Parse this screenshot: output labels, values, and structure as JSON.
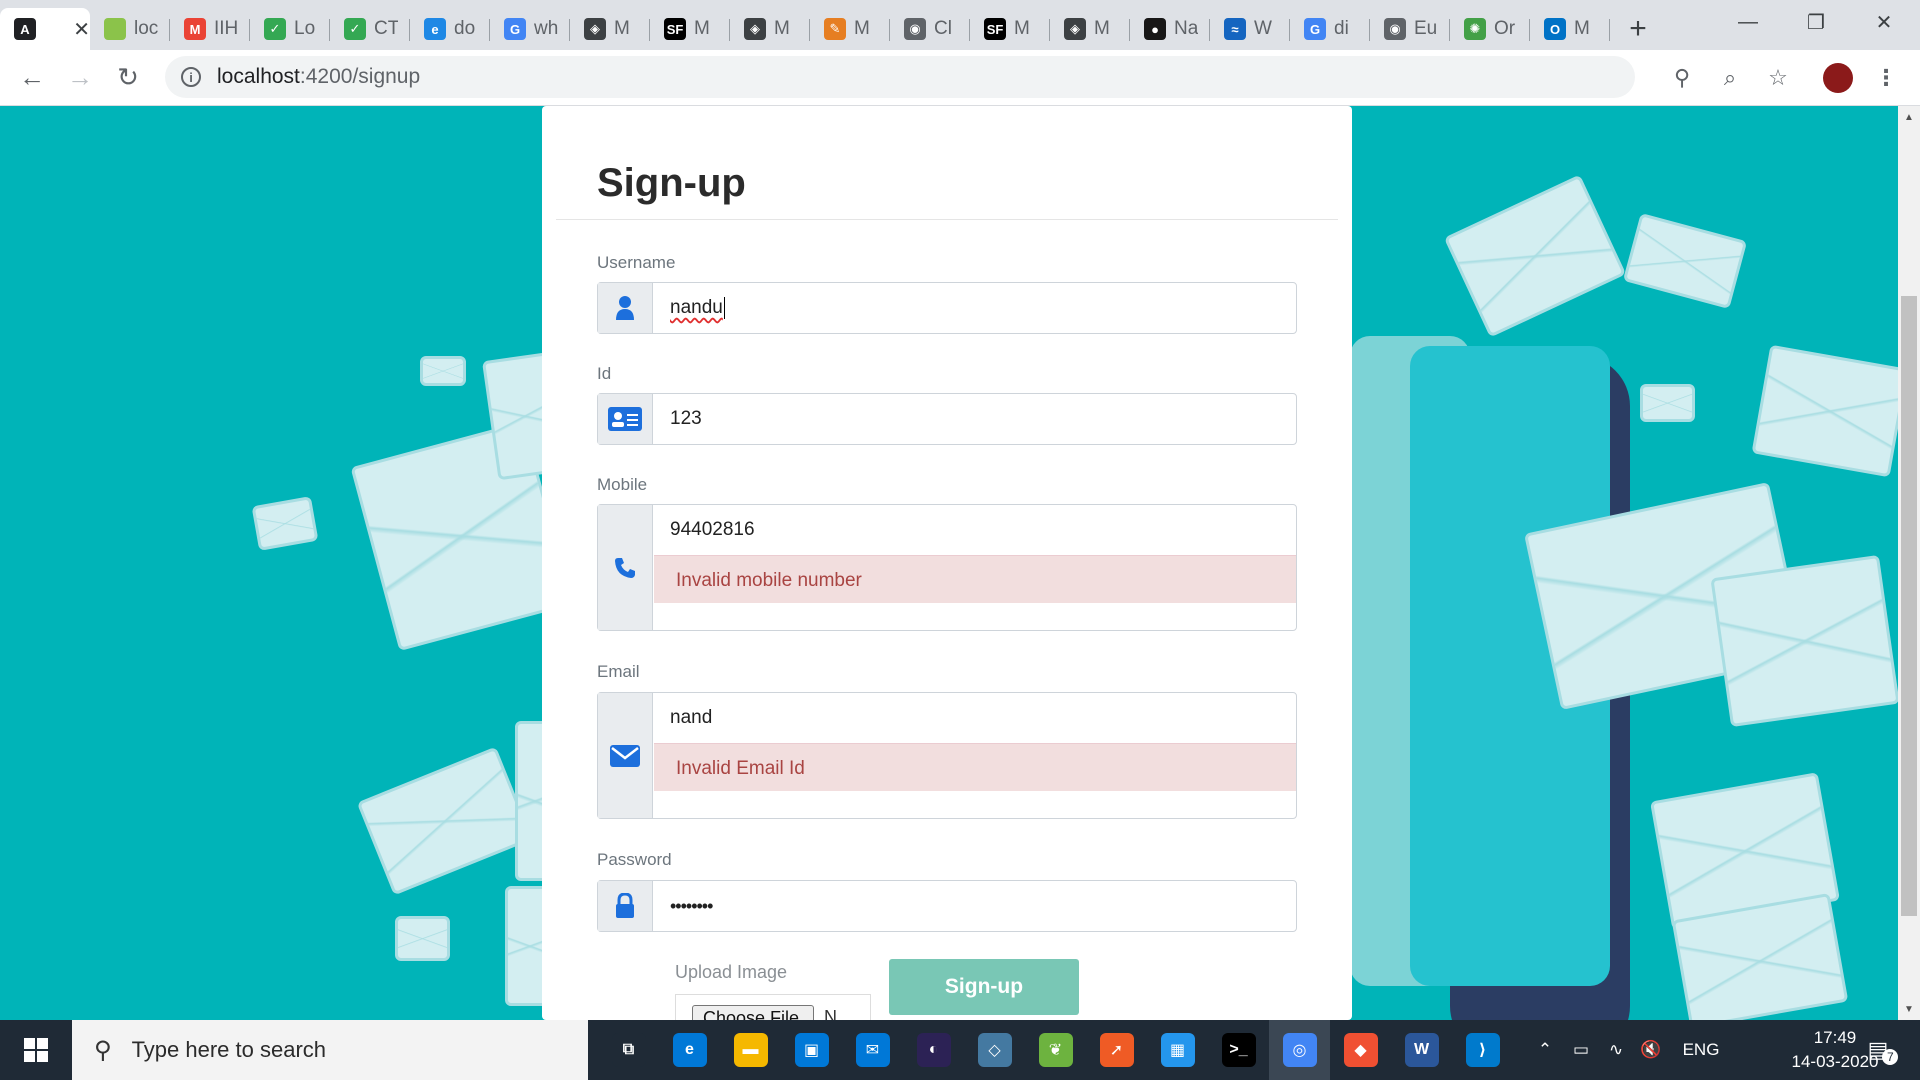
{
  "browser": {
    "tabs": [
      {
        "title": "",
        "icon": "angular-icon",
        "color": "#202124",
        "glyph": "A",
        "active": true
      },
      {
        "title": "loc",
        "icon": "leaf-icon",
        "color": "#8bc34a",
        "glyph": ""
      },
      {
        "title": "IIH",
        "icon": "gmail-icon",
        "color": "#ea4335",
        "glyph": "M"
      },
      {
        "title": "Lo",
        "icon": "check-icon",
        "color": "#34a853",
        "glyph": "✓"
      },
      {
        "title": "CT",
        "icon": "check-icon",
        "color": "#34a853",
        "glyph": "✓"
      },
      {
        "title": "do",
        "icon": "edge-icon",
        "color": "#1e88e5",
        "glyph": "e"
      },
      {
        "title": "wh",
        "icon": "google-icon",
        "color": "#4285f4",
        "glyph": "G"
      },
      {
        "title": "M",
        "icon": "diamond-icon",
        "color": "#3c4043",
        "glyph": "◈"
      },
      {
        "title": "M",
        "icon": "sf-icon",
        "color": "#000000",
        "glyph": "SF"
      },
      {
        "title": "M",
        "icon": "diamond-icon",
        "color": "#3c4043",
        "glyph": "◈"
      },
      {
        "title": "M",
        "icon": "brush-icon",
        "color": "#e67e22",
        "glyph": "✎"
      },
      {
        "title": "Cl",
        "icon": "globe-icon",
        "color": "#5f6368",
        "glyph": "◉"
      },
      {
        "title": "M",
        "icon": "sf-icon",
        "color": "#000000",
        "glyph": "SF"
      },
      {
        "title": "M",
        "icon": "diamond-icon",
        "color": "#3c4043",
        "glyph": "◈"
      },
      {
        "title": "Na",
        "icon": "github-icon",
        "color": "#181717",
        "glyph": "●"
      },
      {
        "title": "W",
        "icon": "wave-icon",
        "color": "#1565c0",
        "glyph": "≈"
      },
      {
        "title": "di",
        "icon": "google-icon",
        "color": "#4285f4",
        "glyph": "G"
      },
      {
        "title": "Eu",
        "icon": "globe-icon",
        "color": "#5f6368",
        "glyph": "◉"
      },
      {
        "title": "Or",
        "icon": "spinner-icon",
        "color": "#43a047",
        "glyph": "✺"
      },
      {
        "title": "M",
        "icon": "outlook-icon",
        "color": "#0072c6",
        "glyph": "O"
      }
    ],
    "new_tab": "+",
    "url_host": "localhost",
    "url_path": ":4200/signup"
  },
  "form": {
    "title": "Sign-up",
    "username_label": "Username",
    "username_value": "nandu",
    "id_label": "Id",
    "id_value": "123",
    "mobile_label": "Mobile",
    "mobile_value": "94402816",
    "mobile_error": "Invalid mobile number",
    "email_label": "Email",
    "email_value": "nand",
    "email_error": "Invalid Email Id",
    "password_label": "Password",
    "password_value": "••••••••",
    "upload_label": "Upload Image",
    "choose_file": "Choose File",
    "no_file": "N",
    "signup_button": "Sign-up"
  },
  "taskbar": {
    "search_placeholder": "Type here to search",
    "apps": [
      {
        "icon": "task-view-icon",
        "color": "#1f2a36",
        "glyph": "⧉"
      },
      {
        "icon": "edge-icon",
        "color": "#0078d7",
        "glyph": "e"
      },
      {
        "icon": "file-explorer-icon",
        "color": "#f5b800",
        "glyph": "▬"
      },
      {
        "icon": "store-icon",
        "color": "#0078d7",
        "glyph": "▣"
      },
      {
        "icon": "mail-icon",
        "color": "#0078d7",
        "glyph": "✉"
      },
      {
        "icon": "eclipse-icon",
        "color": "#2c2255",
        "glyph": "◐"
      },
      {
        "icon": "mysql-workbench-icon",
        "color": "#4479a1",
        "glyph": "◇"
      },
      {
        "icon": "spring-icon",
        "color": "#6db33f",
        "glyph": "❦"
      },
      {
        "icon": "postman-icon",
        "color": "#ef5b25",
        "glyph": "➚"
      },
      {
        "icon": "docker-icon",
        "color": "#2496ed",
        "glyph": "▦"
      },
      {
        "icon": "terminal-icon",
        "color": "#000000",
        "glyph": ">_"
      },
      {
        "icon": "chrome-icon",
        "color": "#4285f4",
        "glyph": "◎"
      },
      {
        "icon": "git-icon",
        "color": "#f05032",
        "glyph": "◆"
      },
      {
        "icon": "word-icon",
        "color": "#2b579a",
        "glyph": "W"
      },
      {
        "icon": "vscode-icon",
        "color": "#007acc",
        "glyph": "⟩"
      }
    ],
    "language": "ENG",
    "time": "17:49",
    "date": "14-03-2020",
    "notifications": "7"
  }
}
